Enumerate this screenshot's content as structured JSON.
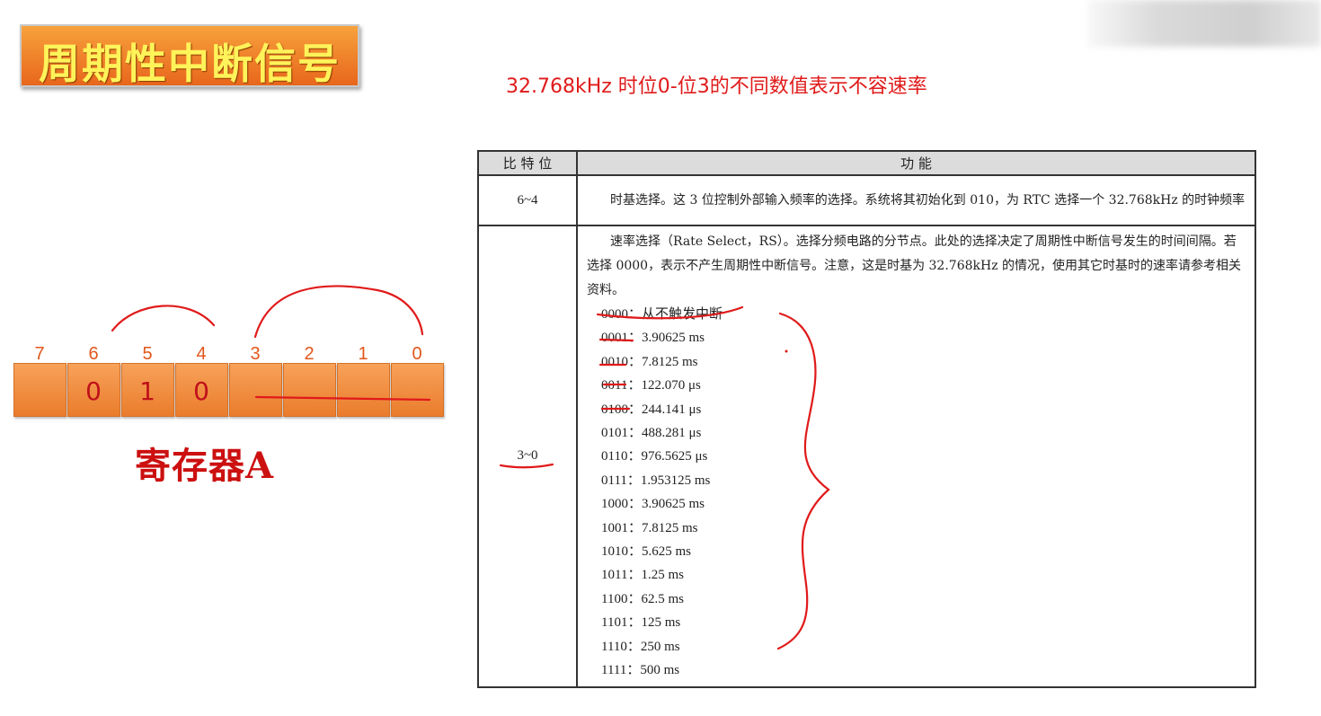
{
  "title": "周期性中断信号",
  "subtitle": "32.768kHz 时位0-位3的不同数值表示不容速率",
  "register": {
    "label": "寄存器A",
    "bit_numbers": [
      "7",
      "6",
      "5",
      "4",
      "3",
      "2",
      "1",
      "0"
    ],
    "handwritten_values": [
      "",
      "0",
      "1",
      "0",
      "",
      "",
      "",
      ""
    ]
  },
  "table": {
    "headers": [
      "比 特 位",
      "功 能"
    ],
    "rows": [
      {
        "bits": "6~4",
        "description": "时基选择。这 3 位控制外部输入频率的选择。系统将其初始化到 010，为 RTC 选择一个 32.768kHz 的时钟频率"
      },
      {
        "bits": "3~0",
        "description": "速率选择（Rate Select，RS）。选择分频电路的分节点。此处的选择决定了周期性中断信号发生的时间间隔。若选择 0000，表示不产生周期性中断信号。注意，这是时基为 32.768kHz 的情况，使用其它时基时的速率请参考相关资料。",
        "rates": [
          "0000：从不触发中断",
          "0001：3.90625 ms",
          "0010：7.8125 ms",
          "0011：122.070 μs",
          "0100：244.141 μs",
          "0101：488.281 μs",
          "0110：976.5625 μs",
          "0111：1.953125 ms",
          "1000：3.90625 ms",
          "1001：7.8125 ms",
          "1010：5.625 ms",
          "1011：1.25 ms",
          "1100：62.5 ms",
          "1101：125 ms",
          "1110：250 ms",
          "1111：500 ms"
        ]
      }
    ]
  },
  "colors": {
    "title_bg": "#ef7a26",
    "title_text": "#fff35a",
    "annotation_red": "#e01a1a",
    "register_orange": "#ea7c2c"
  }
}
